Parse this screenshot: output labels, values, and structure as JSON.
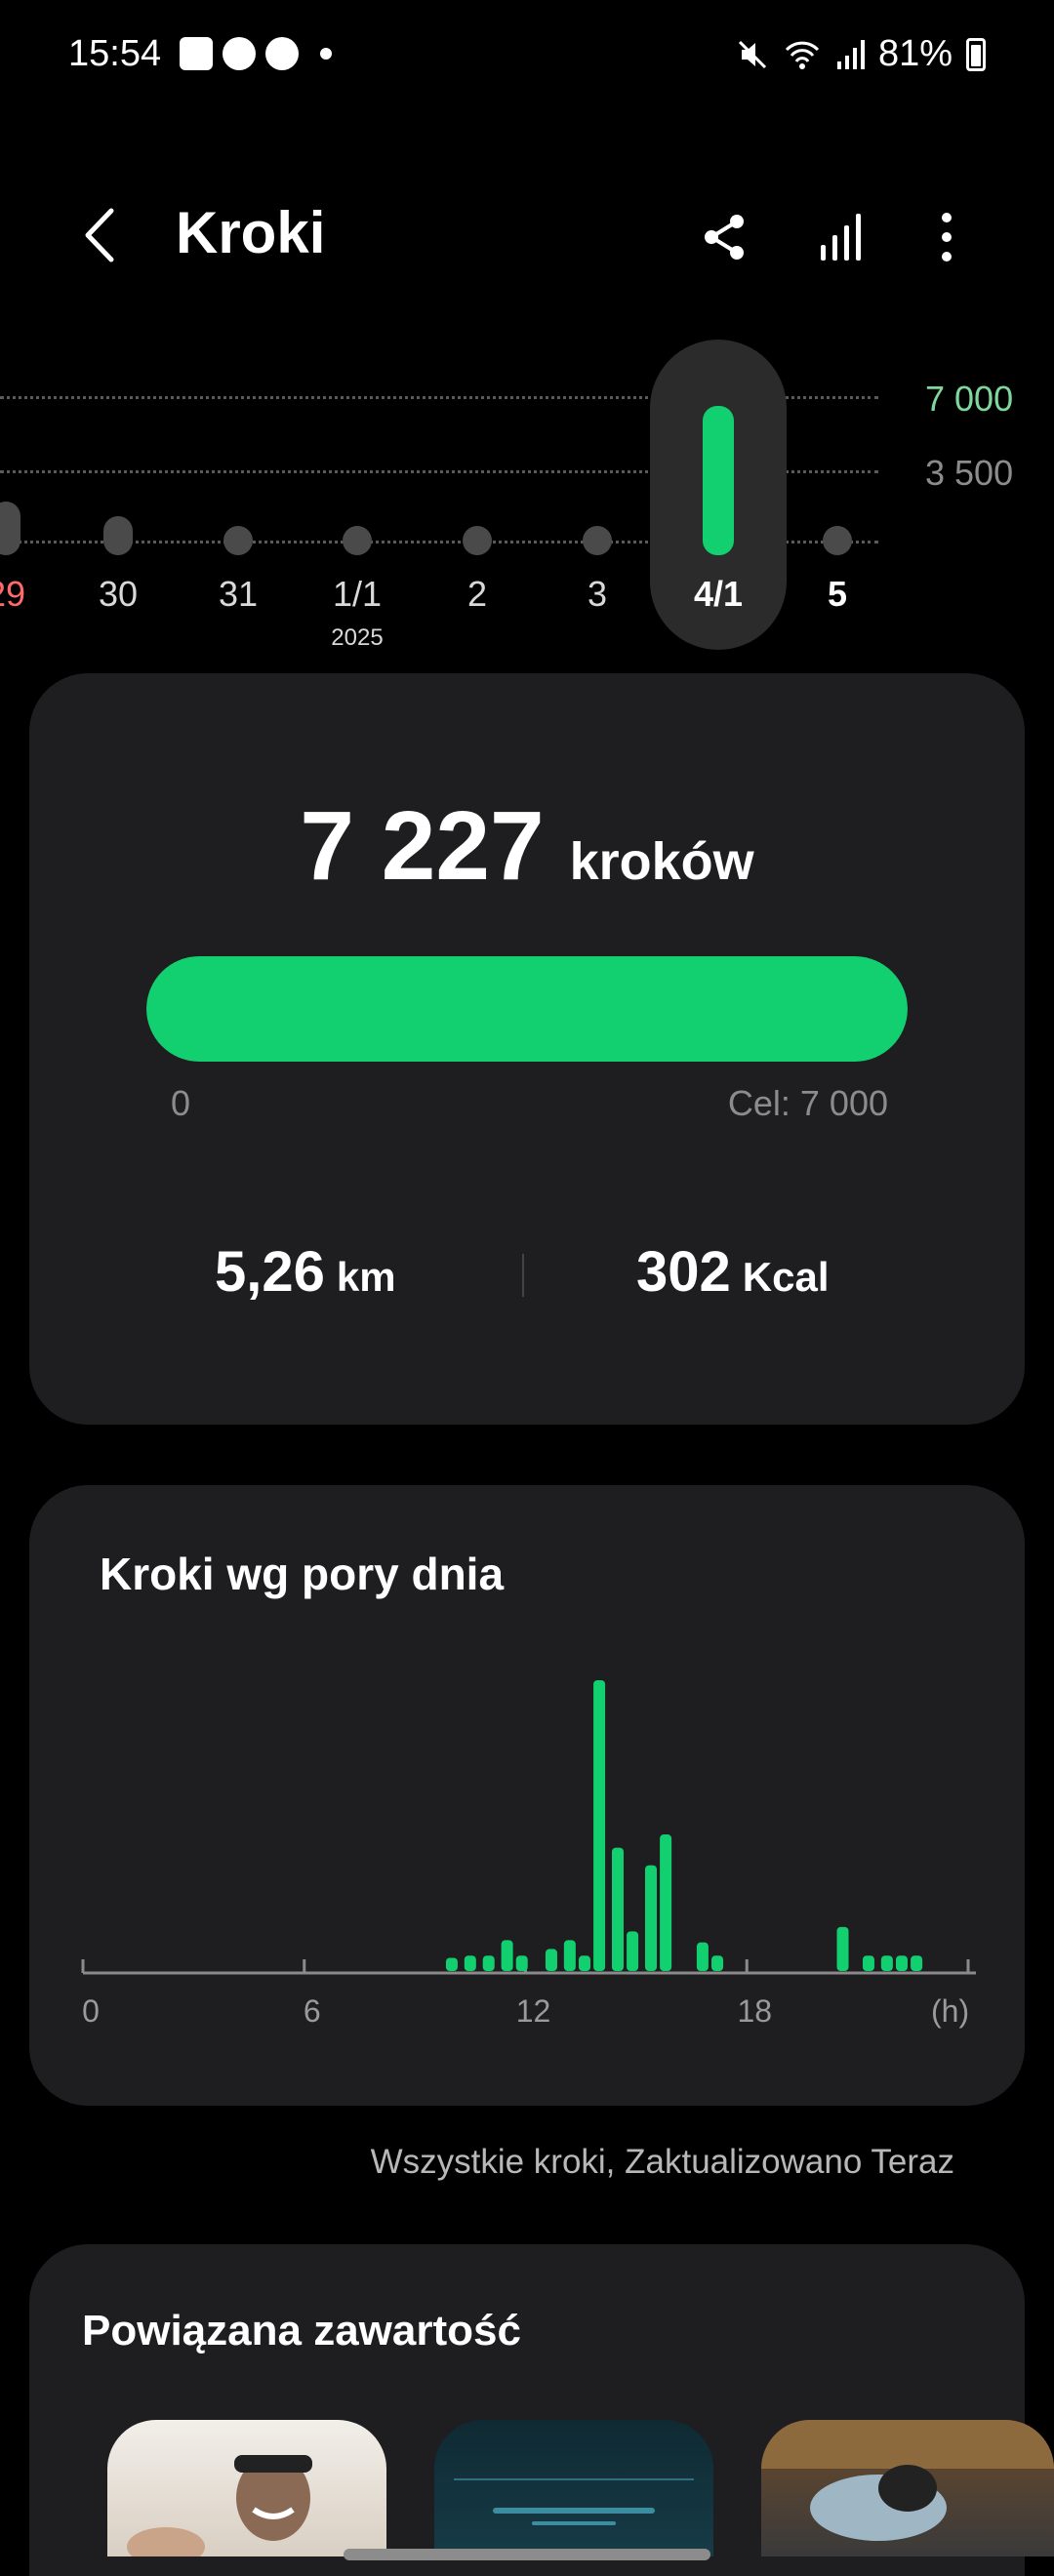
{
  "status_bar": {
    "time": "15:54",
    "battery": "81%",
    "left_icons": [
      "gallery-icon",
      "messenger-icon",
      "dnd-icon",
      "dot-icon"
    ],
    "right_icons": [
      "mute-icon",
      "wifi-icon",
      "signal-icon",
      "battery-icon"
    ]
  },
  "app_bar": {
    "title": "Kroki",
    "actions": [
      "share-icon",
      "stats-icon",
      "more-icon"
    ]
  },
  "week_strip": {
    "y_labels": [
      "7 000",
      "3 500"
    ],
    "days": [
      {
        "label": "29",
        "sub": "",
        "steps": 2600,
        "color": "#ff6b6b"
      },
      {
        "label": "30",
        "sub": "",
        "steps": 1900,
        "color": "#d9d9d9"
      },
      {
        "label": "31",
        "sub": "",
        "steps": 0,
        "color": "#d9d9d9"
      },
      {
        "label": "1/1",
        "sub": "2025",
        "steps": 0,
        "color": "#d9d9d9"
      },
      {
        "label": "2",
        "sub": "",
        "steps": 0,
        "color": "#d9d9d9"
      },
      {
        "label": "3",
        "sub": "",
        "steps": 400,
        "color": "#d9d9d9"
      },
      {
        "label": "4/1",
        "sub": "",
        "steps": 7227,
        "color": "#ffffff",
        "selected": true
      },
      {
        "label": "5",
        "sub": "",
        "steps": 0,
        "color": "#ffffff"
      }
    ],
    "goal_color": "#7fd89b",
    "grid_color": "#8c8c8c"
  },
  "summary": {
    "steps_value": "7 227",
    "steps_unit": "kroków",
    "progress_fraction": 1.0,
    "min_label": "0",
    "goal_label": "Cel: 7 000",
    "distance_value": "5,26",
    "distance_unit": "km",
    "calories_value": "302",
    "calories_unit": "Kcal"
  },
  "chart_data": {
    "type": "bar",
    "title": "Kroki wg pory dnia",
    "x_ticks": [
      "0",
      "6",
      "12",
      "18",
      "(h)"
    ],
    "xlim": [
      0,
      24
    ],
    "x": [
      10.0,
      10.5,
      11.0,
      11.5,
      11.9,
      12.7,
      13.2,
      13.6,
      14.0,
      14.5,
      14.9,
      15.4,
      15.8,
      16.8,
      17.2,
      20.6,
      21.3,
      21.8,
      22.2,
      22.6
    ],
    "values": [
      60,
      70,
      70,
      140,
      70,
      100,
      140,
      70,
      1320,
      560,
      180,
      480,
      620,
      130,
      70,
      200,
      70,
      70,
      70,
      70
    ],
    "color": "#12d06f"
  },
  "footer_note": "Wszystkie kroki, Zaktualizowano Teraz",
  "related": {
    "title": "Powiązana zawartość"
  },
  "colors": {
    "accent": "#12d06f",
    "card": "#1e1e20",
    "background": "#000000"
  }
}
